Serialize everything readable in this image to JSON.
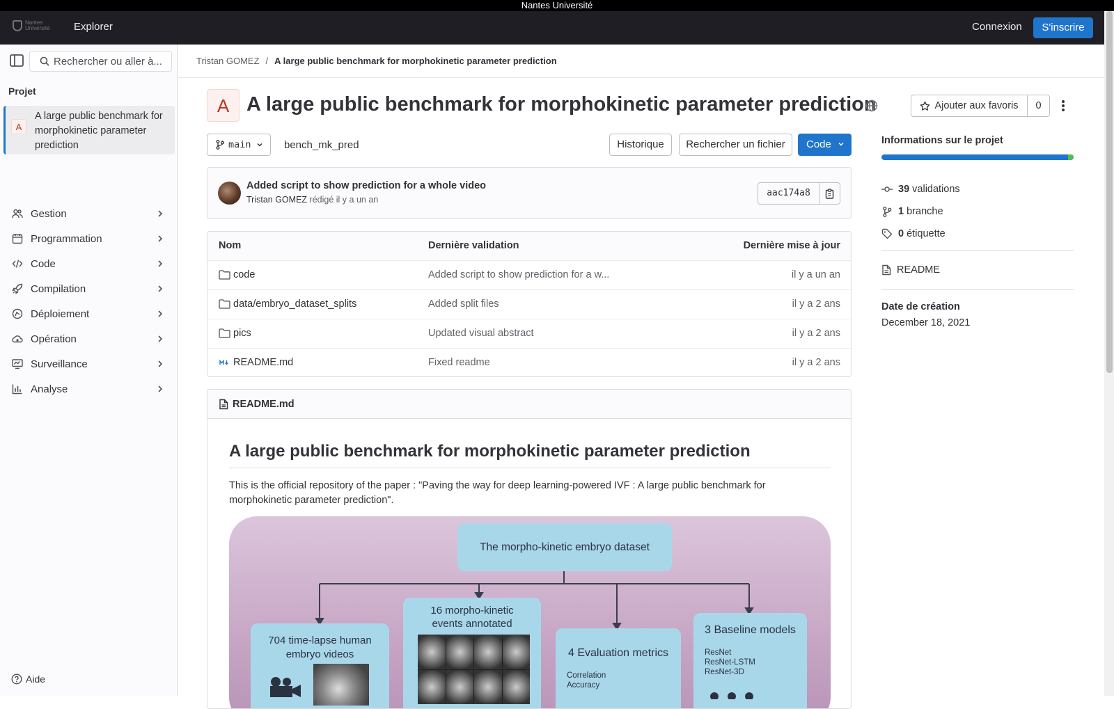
{
  "system_bar": {
    "title": "Nantes Université"
  },
  "topnav": {
    "logo_alt": "Nantes Université",
    "explore_label": "Explorer",
    "login_label": "Connexion",
    "signup_label": "S'inscrire"
  },
  "sidebar": {
    "search_placeholder": "Rechercher ou aller à...",
    "section_title": "Projet",
    "project_avatar": "A",
    "project_name": "A large public benchmark for morphokinetic parameter prediction",
    "items": [
      {
        "label": "Gestion",
        "icon": "users-icon"
      },
      {
        "label": "Programmation",
        "icon": "calendar-icon"
      },
      {
        "label": "Code",
        "icon": "code-icon"
      },
      {
        "label": "Compilation",
        "icon": "rocket-icon"
      },
      {
        "label": "Déploiement",
        "icon": "deploy-icon"
      },
      {
        "label": "Opération",
        "icon": "cloud-gear-icon"
      },
      {
        "label": "Surveillance",
        "icon": "monitor-icon"
      },
      {
        "label": "Analyse",
        "icon": "chart-icon"
      }
    ],
    "help_label": "Aide"
  },
  "breadcrumb": {
    "owner": "Tristan GOMEZ",
    "separator": "/",
    "current": "A large public benchmark for morphokinetic parameter prediction"
  },
  "project": {
    "avatar": "A",
    "title": "A large public benchmark for morphokinetic parameter prediction",
    "favorite_label": "Ajouter aux favoris",
    "favorite_count": "0"
  },
  "toolbar": {
    "branch": "main",
    "repo_name": "bench_mk_pred",
    "history_label": "Historique",
    "find_file_label": "Rechercher un fichier",
    "code_label": "Code"
  },
  "last_commit": {
    "message": "Added script to show prediction for a whole video",
    "author": "Tristan GOMEZ",
    "action": "rédigé",
    "time": "il y a un an",
    "sha": "aac174a8"
  },
  "files": {
    "headers": [
      "Nom",
      "Dernière validation",
      "Dernière mise à jour"
    ],
    "rows": [
      {
        "name": "code",
        "commit": "Added script to show prediction for a w...",
        "updated": "il y a un an",
        "type": "folder"
      },
      {
        "name": "data/embryo_dataset_splits",
        "commit": "Added split files",
        "updated": "il y a 2 ans",
        "type": "folder"
      },
      {
        "name": "pics",
        "commit": "Updated visual abstract",
        "updated": "il y a 2 ans",
        "type": "folder"
      },
      {
        "name": "README.md",
        "commit": "Fixed readme",
        "updated": "il y a 2 ans",
        "type": "markdown"
      }
    ]
  },
  "readme": {
    "filename": "README.md",
    "heading": "A large public benchmark for morphokinetic parameter prediction",
    "paragraph": "This is the official repository of the paper : \"Paving the way for deep learning-powered IVF : A large public benchmark for morphokinetic parameter prediction\".",
    "figure": {
      "root": "The morpho-kinetic embryo dataset",
      "box1": "704 time-lapse human embryo videos",
      "box2": "16 morpho-kinetic events annotated",
      "box3_title": "4 Evaluation metrics",
      "box3_items": [
        "Correlation",
        "Accuracy"
      ],
      "box4_title": "3 Baseline models",
      "box4_items": [
        "ResNet",
        "ResNet-LSTM",
        "ResNet-3D"
      ]
    }
  },
  "project_info": {
    "title": "Informations sur le projet",
    "commits_count": "39",
    "commits_label": "validations",
    "branches_count": "1",
    "branches_label": "branche",
    "tags_count": "0",
    "tags_label": "étiquette",
    "readme_link": "README",
    "created_label": "Date de création",
    "created_date": "December 18, 2021",
    "language_share": 0.97,
    "colors": {
      "primary": "#1f75cb",
      "secondary": "#52c04b"
    }
  }
}
